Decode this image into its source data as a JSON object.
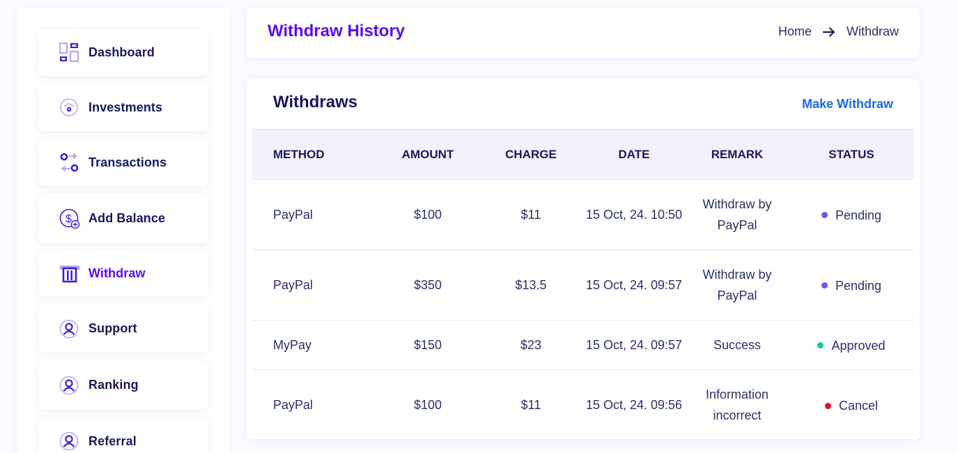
{
  "sidebar": {
    "items": [
      {
        "label": "Dashboard",
        "icon": "dashboard-icon"
      },
      {
        "label": "Investments",
        "icon": "investment-icon"
      },
      {
        "label": "Transactions",
        "icon": "transactions-icon"
      },
      {
        "label": "Add Balance",
        "icon": "add-balance-icon"
      },
      {
        "label": "Withdraw",
        "icon": "withdraw-icon",
        "active": true
      },
      {
        "label": "Support",
        "icon": "user-icon"
      },
      {
        "label": "Ranking",
        "icon": "user-icon"
      },
      {
        "label": "Referral",
        "icon": "user-icon"
      }
    ]
  },
  "header": {
    "title": "Withdraw History",
    "breadcrumb": {
      "home": "Home",
      "current": "Withdraw"
    }
  },
  "withdraws": {
    "title": "Withdraws",
    "action_label": "Make Withdraw",
    "columns": {
      "method": "METHOD",
      "amount": "AMOUNT",
      "charge": "CHARGE",
      "date": "DATE",
      "remark": "REMARK",
      "status": "STATUS"
    },
    "rows": [
      {
        "method": "PayPal",
        "amount": "$100",
        "charge": "$11",
        "date": "15 Oct, 24. 10:50",
        "remark": "Withdraw by PayPal",
        "status": "Pending",
        "status_color": "#7b4cf0"
      },
      {
        "method": "PayPal",
        "amount": "$350",
        "charge": "$13.5",
        "date": "15 Oct, 24. 09:57",
        "remark": "Withdraw by PayPal",
        "status": "Pending",
        "status_color": "#7b4cf0"
      },
      {
        "method": "MyPay",
        "amount": "$150",
        "charge": "$23",
        "date": "15 Oct, 24. 09:57",
        "remark": "Success",
        "status": "Approved",
        "status_color": "#12c99b"
      },
      {
        "method": "PayPal",
        "amount": "$100",
        "charge": "$11",
        "date": "15 Oct, 24. 09:56",
        "remark": "Information incorrect",
        "status": "Cancel",
        "status_color": "#e8101a"
      }
    ]
  },
  "colors": {
    "accent": "#5b0cf0",
    "link": "#1a6ae8",
    "heading": "#16195a",
    "table_header_bg": "#f4f1ff"
  }
}
